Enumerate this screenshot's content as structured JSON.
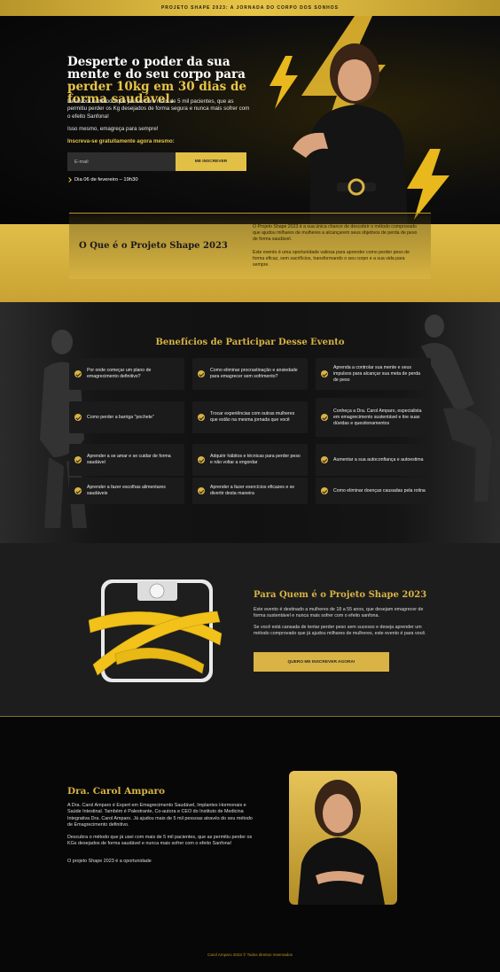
{
  "topbar": {
    "text": "PROJETO SHAPE 2023: A JORNADA DO CORPO DOS SONHOS"
  },
  "hero": {
    "headline_start": "Desperte o poder da sua mente e do seu corpo para ",
    "headline_highlight": "perder 10kg em 30 dias de forma saudável.",
    "paragraph": "Descubra o método que já usei com mais de 5 mil pacientes, que as permitiu perder os Kg desejados de forma segura e nunca mais sofrer com o efeito Sanfona!",
    "tagline": "Isso mesmo, emagreça para sempre!",
    "cta_label": "Inscreva-se gratuitamente agora mesmo:",
    "email_placeholder": "E-mail",
    "subscribe_button": "ME INSCREVER",
    "date": "Dia 06 de fevereiro – 19h30"
  },
  "about": {
    "title": "O Que é o Projeto Shape 2023",
    "p1": "O Projeto Shape 2023 é a sua única chance de descobrir o método comprovado que ajudou milhares de mulheres a alcançarem seus objetivos de perda de peso de forma saudável.",
    "p2": "Este evento é uma oportunidade valiosa para aprender como perder peso de forma eficaz, sem sacrifícios, transformando o seu corpo e a sua vida para sempre."
  },
  "benefits": {
    "title": "Benefícios de Participar Desse Evento",
    "items": [
      "Por onde começar um plano de emagrecimento definitivo?",
      "Como eliminar procrastinação e ansiedade para emagrecer sem sofrimento?",
      "Aprenda a controlar sua mente e seus impulsos para alcançar sua meta de perda de peso",
      "Como perder a barriga \"pochete\"",
      "Trocar experiências com outras mulheres que estão na mesma jornada que você",
      "Conheça a Dra. Carol Amparo, especialista em emagrecimento sustentável e tire suas dúvidas e questionamentos",
      "Aprender a se amar e se cuidar de forma saudável",
      "Adquirir hábitos e técnicas para perder peso e não voltar a engordar",
      "Aumentar a sua autoconfiança e autoestima",
      "Aprender a fazer escolhas alimentares saudáveis",
      "Aprender a fazer exercícios eficazes e se divertir desta maneira",
      "Como eliminar doenças causadas pela rotina"
    ]
  },
  "for_whom": {
    "title": "Para Quem é o Projeto Shape 2023",
    "p1": "Este evento é destinado a mulheres de 18 a 55 anos, que desejam emagrecer de forma sustentável e nunca mais sofrer com o efeito sanfona.",
    "p2": "Se você está cansada de tentar perder peso sem sucesso e deseja aprender um método comprovado que já ajudou milhares de mulheres, este evento é para você.",
    "button": "QUERO ME INSCREVER AGORA!"
  },
  "doctor": {
    "title": "Dra. Carol Amparo",
    "p1": "A Dra. Carol Amparo é Expert em Emagrecimento Saudável, Implantes Hormonais e Saúde Intestinal. Também é Palestrante, Co-autora e CEO do Instituto de Medicina Integrativa Dra. Carol Amparo. Já ajudou mais de 5 mil pessoas através do seu método de Emagrecimento definitivo.",
    "p2": "Descubra o método que já usei com mais de 5 mil pacientes, que as permitiu perder os KGs desejados de forma saudável e nunca mais sofrer com o efeito Sanfona!",
    "p3": "O projeto Shape 2023 é a oportunidade"
  },
  "footer": {
    "text": "Carol Amparo 2023 © Todos direitos reservados"
  },
  "colors": {
    "gold": "#e2bf45",
    "dark": "#0b0b0b"
  }
}
